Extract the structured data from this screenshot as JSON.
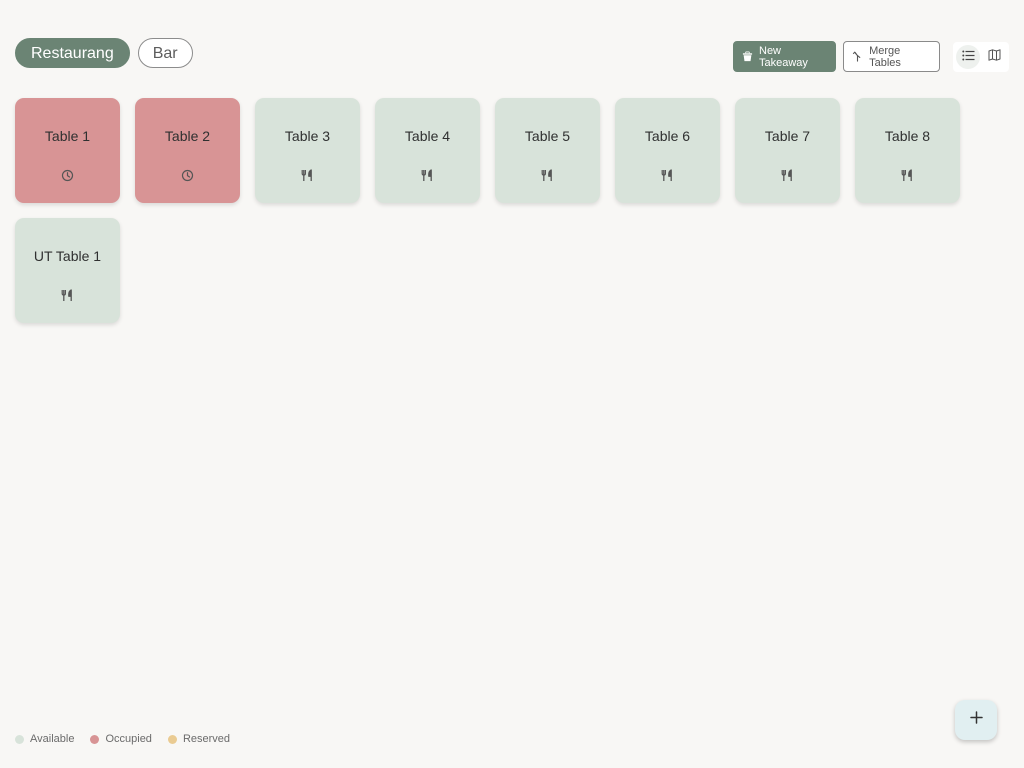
{
  "area_tabs": [
    {
      "label": "Restaurang",
      "active": true
    },
    {
      "label": "Bar",
      "active": false
    }
  ],
  "toolbar": {
    "new_takeaway_label": "New Takeaway",
    "merge_tables_label": "Merge Tables",
    "new_takeaway_icon": "takeaway-bag-icon",
    "merge_tables_icon": "merge-icon",
    "view_list_icon": "list-view-icon",
    "view_map_icon": "map-view-icon",
    "active_view": "list"
  },
  "tables": [
    {
      "name": "Table 1",
      "status": "occupied",
      "icon": "clock-icon"
    },
    {
      "name": "Table 2",
      "status": "occupied",
      "icon": "clock-icon"
    },
    {
      "name": "Table 3",
      "status": "available",
      "icon": "cutlery-icon"
    },
    {
      "name": "Table 4",
      "status": "available",
      "icon": "cutlery-icon"
    },
    {
      "name": "Table 5",
      "status": "available",
      "icon": "cutlery-icon"
    },
    {
      "name": "Table 6",
      "status": "available",
      "icon": "cutlery-icon"
    },
    {
      "name": "Table 7",
      "status": "available",
      "icon": "cutlery-icon"
    },
    {
      "name": "Table 8",
      "status": "available",
      "icon": "cutlery-icon"
    },
    {
      "name": "UT Table 1",
      "status": "available",
      "icon": "cutlery-icon"
    }
  ],
  "legend": [
    {
      "label": "Available",
      "color": "#d8e3da"
    },
    {
      "label": "Occupied",
      "color": "#d89495"
    },
    {
      "label": "Reserved",
      "color": "#eacb92"
    }
  ],
  "fab": {
    "icon": "plus-icon"
  },
  "colors": {
    "primary": "#6b8474",
    "available": "#d8e3da",
    "occupied": "#d89495",
    "reserved": "#eacb92",
    "background": "#f8f7f5"
  }
}
